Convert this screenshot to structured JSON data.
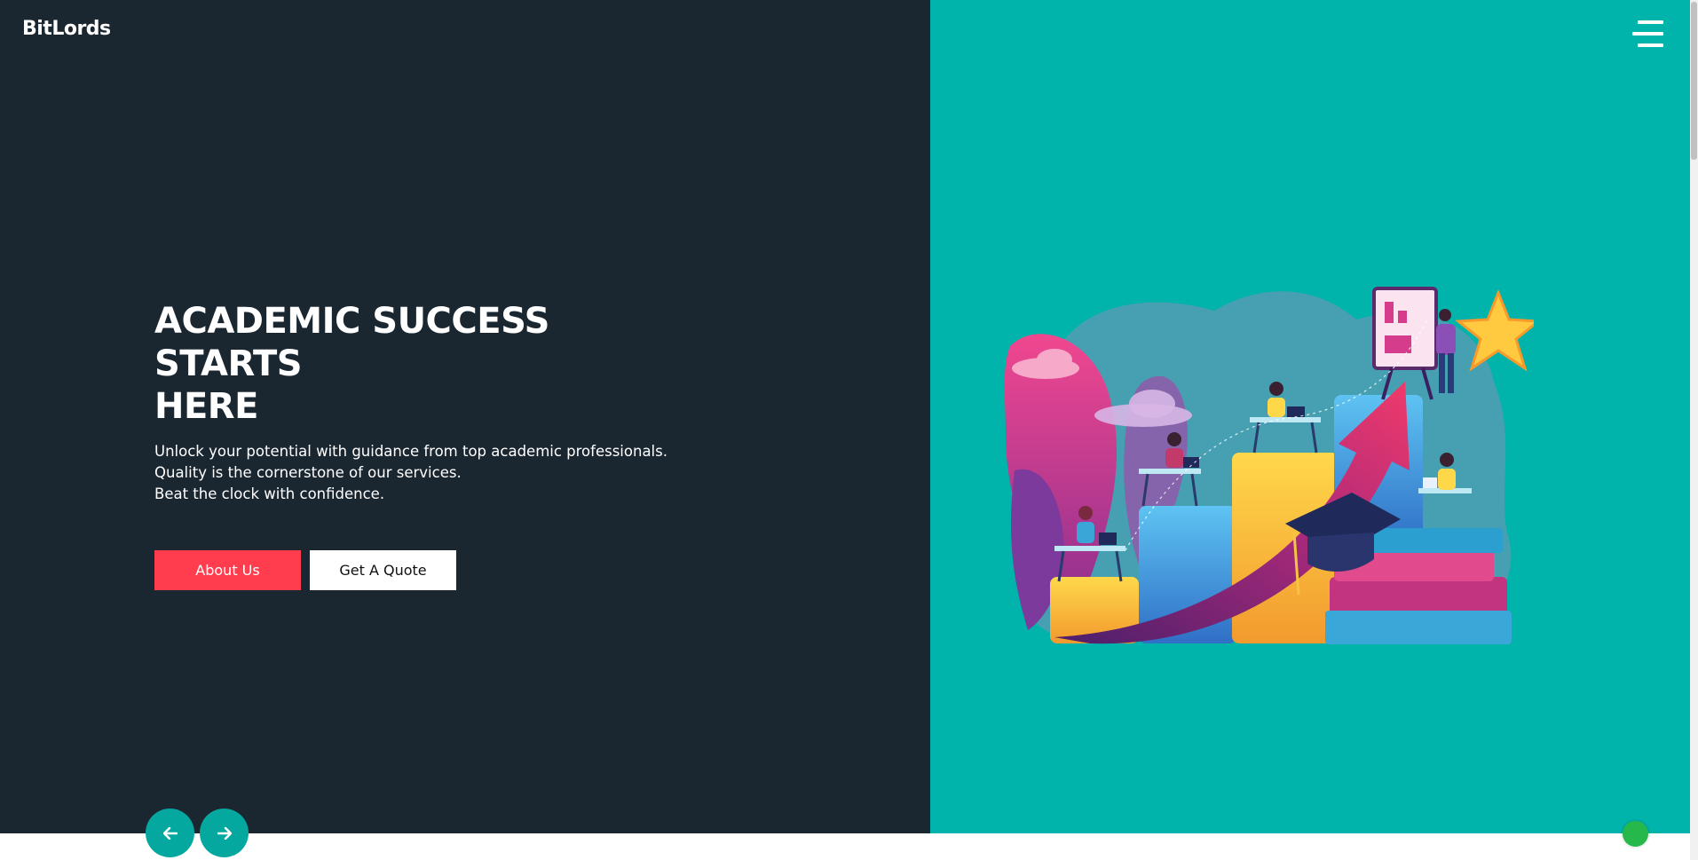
{
  "header": {
    "logo_text": "BitLords",
    "menu_icon": "hamburger-menu-icon"
  },
  "hero": {
    "title_lines": [
      "ACADEMIC SUCCESS",
      "STARTS",
      "HERE"
    ],
    "description_lines": [
      "Unlock your potential with guidance from top academic professionals.",
      "Quality is the cornerstone of our services.",
      "Beat the clock with confidence."
    ],
    "buttons": {
      "about_label": "About Us",
      "quote_label": "Get A Quote"
    }
  },
  "slider": {
    "prev_icon": "arrow-left-icon",
    "next_icon": "arrow-right-icon"
  },
  "illustration": {
    "icon": "academic-growth-illustration"
  },
  "colors": {
    "left_panel": "#1b2730",
    "right_panel": "#00b3ab",
    "accent_red": "#ff3d4f",
    "nav_teal": "#05a89f",
    "chat_green": "#26b84a"
  }
}
